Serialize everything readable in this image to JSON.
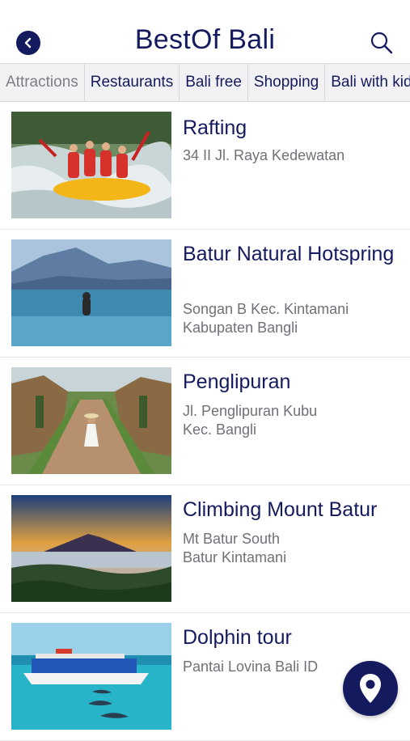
{
  "header": {
    "title": "BestOf Bali",
    "back_icon": "back-arrow-icon",
    "search_icon": "search-icon"
  },
  "tabs": [
    {
      "label": "Attractions",
      "active": false
    },
    {
      "label": "Restaurants",
      "active": true
    },
    {
      "label": "Bali free",
      "active": true
    },
    {
      "label": "Shopping",
      "active": true
    },
    {
      "label": "Bali with kids",
      "active": true
    }
  ],
  "places": [
    {
      "name": "Rafting",
      "address": "34 II Jl. Raya Kedewatan",
      "image": "rafting-photo"
    },
    {
      "name": "Batur Natural Hotspring",
      "address": "Songan B Kec. Kintamani\nKabupaten Bangli",
      "image": "hotspring-photo"
    },
    {
      "name": "Penglipuran",
      "address": "Jl. Penglipuran Kubu\nKec. Bangli",
      "image": "village-photo"
    },
    {
      "name": "Climbing Mount Batur",
      "address": "Mt Batur South\nBatur Kintamani",
      "image": "mountain-photo"
    },
    {
      "name": "Dolphin tour",
      "address": "Pantai Lovina Bali ID",
      "image": "boat-photo"
    }
  ],
  "fab": {
    "icon": "map-pin-icon"
  },
  "colors": {
    "primary": "#141a5e",
    "tab_bg": "#f2f2f4",
    "muted_text": "#707078"
  }
}
